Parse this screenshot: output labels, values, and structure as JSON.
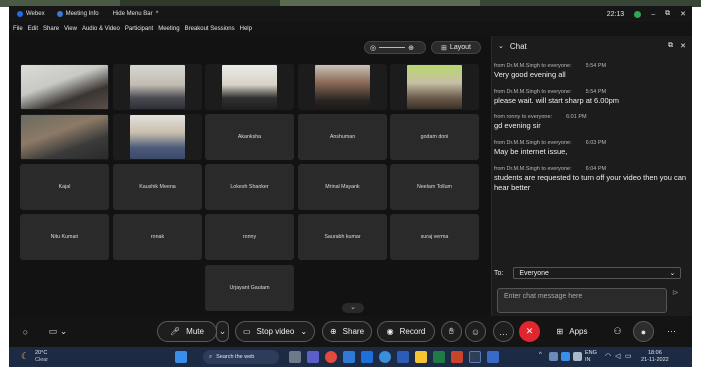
{
  "titlebar": {
    "app_name": "Webex",
    "meeting_info": "Meeting Info",
    "hide_menu": "Hide Menu Bar",
    "time": "22:13",
    "minimize": "–",
    "restore": "⧉",
    "close": "✕"
  },
  "menu": [
    "File",
    "Edit",
    "Share",
    "View",
    "Audio & Video",
    "Participant",
    "Meeting",
    "Breakout Sessions",
    "Help"
  ],
  "layout_label": "Layout",
  "participants_video": [
    "",
    "",
    "",
    "",
    "",
    "",
    ""
  ],
  "participants": [
    "Akanksha",
    "Anshuman",
    "godam doni",
    "Kajal",
    "Kaushik Meena",
    "Lokesh Shanker",
    "Mrinal Mayank",
    "Neelam Tollum",
    "Nitu Kumari",
    "ronak",
    "ronny",
    "Saurabh kumar",
    "suraj verma",
    "Urjayant Gautam"
  ],
  "chat": {
    "title": "Chat",
    "messages": [
      {
        "from": "from Dr.M.M.Singh to everyone:",
        "time": "5:54 PM",
        "text": "Very good evening all"
      },
      {
        "from": "from Dr.M.M.Singh to everyone:",
        "time": "5:54 PM",
        "text": "please wait. will start sharp at 6.00pm"
      },
      {
        "from": "from ronny to everyone:",
        "time": "6:01 PM",
        "text": "gd evening sir"
      },
      {
        "from": "from Dr.M.M.Singh to everyone:",
        "time": "6:03 PM",
        "text": "May be internet issue,"
      },
      {
        "from": "from Dr.M.M.Singh to everyone:",
        "time": "6:04 PM",
        "text": "students are requested to turn off your video then you can hear better"
      }
    ],
    "to_label": "To:",
    "to_value": "Everyone",
    "input_placeholder": "Enter chat message here"
  },
  "controls": {
    "mute": "Mute",
    "stop_video": "Stop video",
    "share": "Share",
    "record": "Record",
    "apps": "Apps"
  },
  "taskbar": {
    "temp": "20°C",
    "weather": "Clear",
    "search": "Search the web",
    "lang": "ENG",
    "region": "IN",
    "clock": "18:06",
    "date": "21-11-2022"
  },
  "colors": {
    "accent_blue": "#1d6fe6",
    "end_red": "#e0262e",
    "chat_bg": "#1c1c1c",
    "stage_bg": "#121212",
    "tile_bg": "#2a2a2a",
    "taskbar": "#1c2a44"
  }
}
